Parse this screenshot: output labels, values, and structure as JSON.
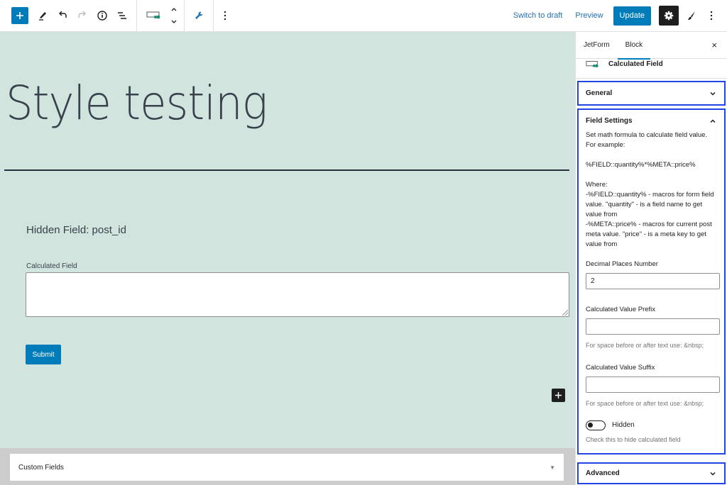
{
  "toolbar": {
    "left_icons": [
      "add-block-icon",
      "edit-pencil-icon",
      "undo-icon",
      "redo-icon",
      "info-icon",
      "list-view-icon"
    ],
    "block_icon": "calculated-field-icon",
    "move_icons": [
      "chevron-up-icon",
      "chevron-down-icon"
    ],
    "tools_icon": "wrench-icon",
    "more_icon": "more-vertical-icon",
    "switch_to_draft": "Switch to draft",
    "preview": "Preview",
    "update": "Update",
    "right_icons": [
      "settings-gear-icon",
      "brush-icon",
      "more-vertical-icon"
    ]
  },
  "canvas": {
    "post_title": "Style testing",
    "hidden_field_text": "Hidden Field: post_id",
    "calculated_field_label": "Calculated Field",
    "calculated_field_value": "",
    "submit_label": "Submit",
    "background_color": "#d1e4dd"
  },
  "metabox": {
    "title": "Custom Fields",
    "arrow": "▼"
  },
  "sidebar": {
    "tabs": [
      {
        "label": "JetForm",
        "active": false
      },
      {
        "label": "Block",
        "active": true
      }
    ],
    "close": "×",
    "block_name": "Calculated Field",
    "panels": {
      "general": {
        "title": "General",
        "expanded": false
      },
      "field_settings": {
        "title": "Field Settings",
        "expanded": true,
        "help_text": "Set math formula to calculate field value.\nFor example:\n\n%FIELD::quantity%*%META::price%\n\nWhere:\n-%FIELD::quantity% - macros for form field value. \"quantity\" - is a field name to get value from\n-%META::price% - macros for current post meta value. \"price\" - is a meta key to get value from",
        "decimal_label": "Decimal Places Number",
        "decimal_value": "2",
        "prefix_label": "Calculated Value Prefix",
        "prefix_value": "",
        "prefix_hint": "For space before or after text use: &nbsp;",
        "suffix_label": "Calculated Value Suffix",
        "suffix_value": "",
        "suffix_hint": "For space before or after text use: &nbsp;",
        "hidden_label": "Hidden",
        "hidden_checked": false,
        "hidden_hint": "Check this to hide calculated field"
      },
      "advanced": {
        "title": "Advanced",
        "expanded": false
      }
    },
    "highlight_color": "#2145e6"
  },
  "colors": {
    "accent": "#007cba",
    "dark": "#1e1e1e"
  }
}
